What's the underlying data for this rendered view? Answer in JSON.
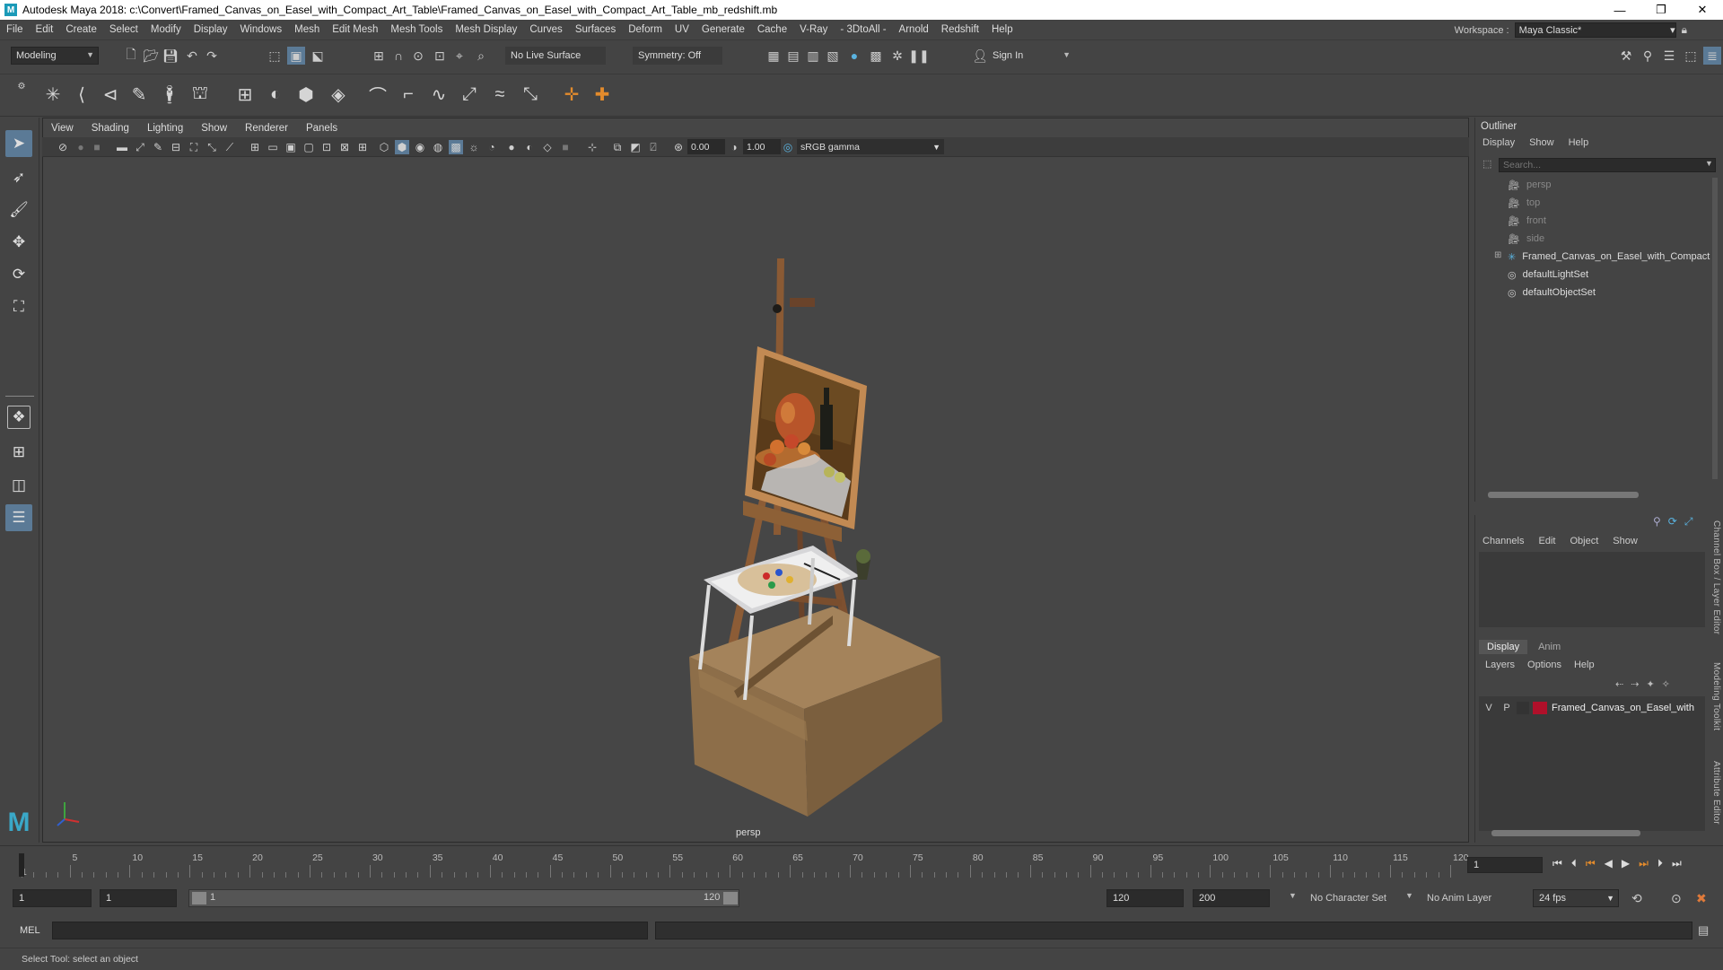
{
  "title_bar": {
    "app_icon": "M",
    "title": "Autodesk Maya 2018: c:\\Convert\\Framed_Canvas_on_Easel_with_Compact_Art_Table\\Framed_Canvas_on_Easel_with_Compact_Art_Table_mb_redshift.mb",
    "minimize": "—",
    "maximize": "❐",
    "close": "✕"
  },
  "menu_bar": {
    "items": [
      "File",
      "Edit",
      "Create",
      "Select",
      "Modify",
      "Display",
      "Windows",
      "Mesh",
      "Edit Mesh",
      "Mesh Tools",
      "Mesh Display",
      "Curves",
      "Surfaces",
      "Deform",
      "UV",
      "Generate",
      "Cache",
      "V-Ray",
      "- 3DtoAll -",
      "Arnold",
      "Redshift",
      "Help"
    ],
    "workspace_label": "Workspace :",
    "workspace_value": "Maya Classic*"
  },
  "status_line": {
    "mode": "Modeling",
    "live_surface": "No Live Surface",
    "symmetry": "Symmetry: Off",
    "sign_in": "Sign In"
  },
  "viewport": {
    "menus": [
      "View",
      "Shading",
      "Lighting",
      "Show",
      "Renderer",
      "Panels"
    ],
    "exposure": "0.00",
    "gamma": "1.00",
    "color_space": "sRGB gamma",
    "camera_label": "persp"
  },
  "outliner": {
    "title": "Outliner",
    "menus": [
      "Display",
      "Show",
      "Help"
    ],
    "search_placeholder": "Search...",
    "items": [
      {
        "label": "persp",
        "icon": "camera-icon",
        "dim": true
      },
      {
        "label": "top",
        "icon": "camera-icon",
        "dim": true
      },
      {
        "label": "front",
        "icon": "camera-icon",
        "dim": true
      },
      {
        "label": "side",
        "icon": "camera-icon",
        "dim": true
      },
      {
        "label": "Framed_Canvas_on_Easel_with_Compact",
        "icon": "transform-icon",
        "dim": false
      },
      {
        "label": "defaultLightSet",
        "icon": "set-icon",
        "dim": false
      },
      {
        "label": "defaultObjectSet",
        "icon": "set-icon",
        "dim": false
      }
    ]
  },
  "channel_box": {
    "menus": [
      "Channels",
      "Edit",
      "Object",
      "Show"
    ],
    "tabs": [
      "Display",
      "Anim"
    ],
    "layer_menus": [
      "Layers",
      "Options",
      "Help"
    ],
    "layer": {
      "v": "V",
      "p": "P",
      "color": "#b0102a",
      "name": "Framed_Canvas_on_Easel_with"
    },
    "side_tabs": [
      "Channel Box / Layer Editor",
      "Modeling Toolkit",
      "Attribute Editor"
    ]
  },
  "timeline": {
    "ticks": [
      "1",
      "5",
      "10",
      "15",
      "20",
      "25",
      "30",
      "35",
      "40",
      "45",
      "50",
      "55",
      "60",
      "65",
      "70",
      "75",
      "80",
      "85",
      "90",
      "95",
      "100",
      "105",
      "110",
      "115",
      "120"
    ],
    "current_frame": "1"
  },
  "range": {
    "start": "1",
    "playback_start": "1",
    "slider_start": "1",
    "slider_end": "120",
    "playback_end": "120",
    "end": "200",
    "character_set": "No Character Set",
    "anim_layer": "No Anim Layer",
    "fps": "24 fps"
  },
  "command_line": {
    "label": "MEL"
  },
  "help_line": {
    "text": "Select Tool: select an object"
  }
}
